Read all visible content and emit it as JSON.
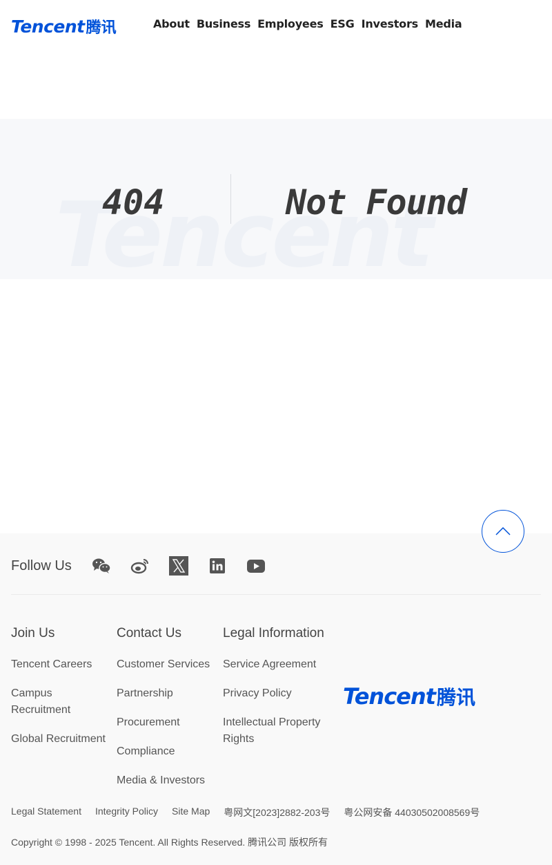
{
  "header": {
    "logo_en": "Tencent",
    "logo_cn": "腾讯",
    "nav": [
      "About",
      "Business",
      "Employees",
      "ESG",
      "Investors",
      "Media"
    ]
  },
  "error": {
    "code": "404",
    "message": "Not Found",
    "watermark": "Tencent"
  },
  "footer": {
    "follow_label": "Follow Us",
    "social_icons": [
      "wechat-icon",
      "weibo-icon",
      "x-icon",
      "linkedin-icon",
      "youtube-icon"
    ],
    "columns": [
      {
        "title": "Join Us",
        "items": [
          "Tencent Careers",
          "Campus Recruitment",
          "Global Recruitment"
        ]
      },
      {
        "title": "Contact Us",
        "items": [
          "Customer Services",
          "Partnership",
          "Procurement",
          "Compliance",
          "Media & Investors"
        ]
      },
      {
        "title": "Legal Information",
        "items": [
          "Service Agreement",
          "Privacy Policy",
          "Intellectual Property Rights"
        ]
      }
    ],
    "logo_en": "Tencent",
    "logo_cn": "腾讯",
    "legal_links": [
      "Legal Statement",
      "Integrity Policy",
      "Site Map",
      "粤网文[2023]2882-203号",
      "粤公网安备 44030502008569号"
    ],
    "copyright": "Copyright © 1998 - 2025 Tencent. All Rights Reserved. 腾讯公司 版权所有"
  },
  "colors": {
    "brand": "#0052d9",
    "footer_bg": "#f9f9f9",
    "band_bg": "#f7f8fa"
  }
}
